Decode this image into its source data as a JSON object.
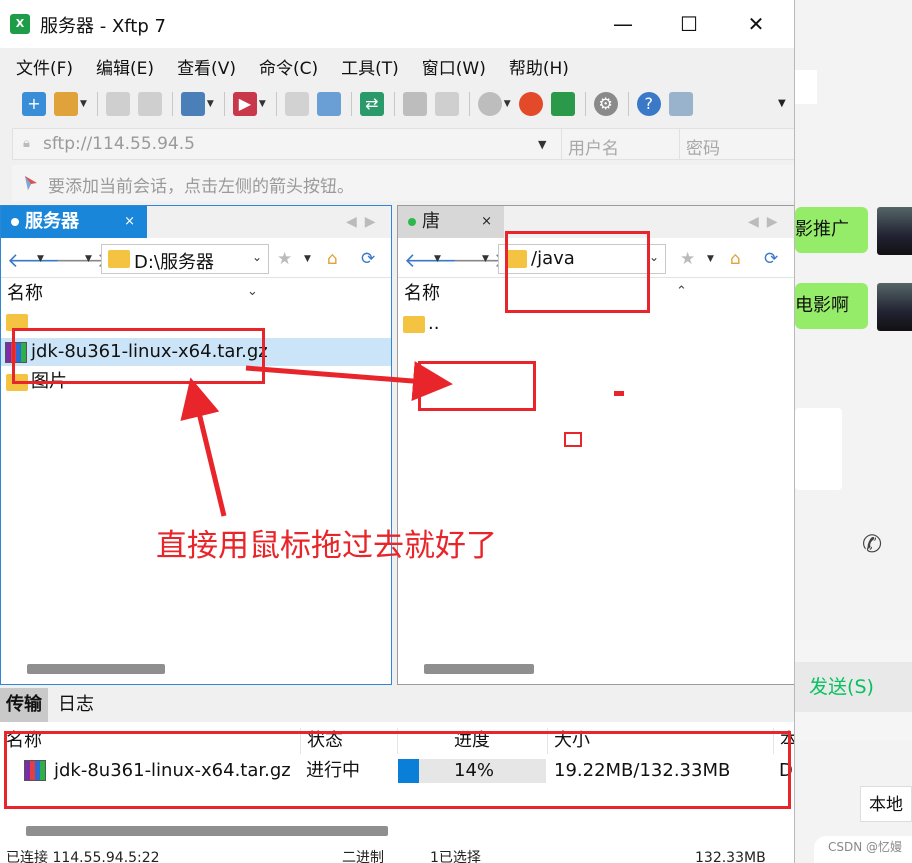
{
  "window": {
    "title": "服务器 - Xftp 7",
    "app_icon": "xftp-logo-icon",
    "controls": {
      "minimize": "—",
      "maximize": "☐",
      "close": "✕"
    }
  },
  "menu": [
    "文件(F)",
    "编辑(E)",
    "查看(V)",
    "命令(C)",
    "工具(T)",
    "窗口(W)",
    "帮助(H)"
  ],
  "address": {
    "url": "sftp://114.55.94.5",
    "username_placeholder": "用户名",
    "password_placeholder": "密码"
  },
  "hint": "要添加当前会话，点击左侧的箭头按钮。",
  "left_pane": {
    "tab_label": "服务器",
    "tab_close": "×",
    "path": "D:\\服务器",
    "column_name": "名称",
    "files": [
      {
        "name": "",
        "type": "folder"
      },
      {
        "name": "jdk-8u361-linux-x64.tar.gz",
        "type": "archive"
      },
      {
        "name": "图片",
        "type": "folder"
      }
    ]
  },
  "right_pane": {
    "tab_label": "唐",
    "tab_close": "×",
    "path": "/java",
    "column_name": "名称",
    "files": [
      {
        "name": "..",
        "type": "folder"
      }
    ]
  },
  "transfer": {
    "tabs": [
      "传输",
      "日志"
    ],
    "columns": [
      "名称",
      "状态",
      "进度",
      "大小",
      "本"
    ],
    "rows": [
      {
        "name": "jdk-8u361-linux-x64.tar.gz",
        "status": "进行中",
        "progress": 0.14,
        "progress_text": "14%",
        "size": "19.22MB/132.33MB",
        "extra": "D"
      }
    ]
  },
  "statusbar": {
    "connection": "已连接 114.55.94.5:22",
    "mode": "二进制",
    "selection": "1已选择",
    "size": "132.33MB"
  },
  "annotation": {
    "text": "直接用鼠标拖过去就好了",
    "color": "#e8252a"
  },
  "background_app": {
    "bubble_1": "影推广",
    "bubble_2": "电影啊",
    "send_button": "发送(S)",
    "local_button": "本地",
    "watermark": "CSDN @忆嫚"
  },
  "colors": {
    "accent": "#1a86d9",
    "selected_row": "#cce4f7",
    "progress": "#0a7fd8",
    "annotation": "#e8252a",
    "chat_bubble": "#95ec69",
    "send_text": "#07c160"
  }
}
